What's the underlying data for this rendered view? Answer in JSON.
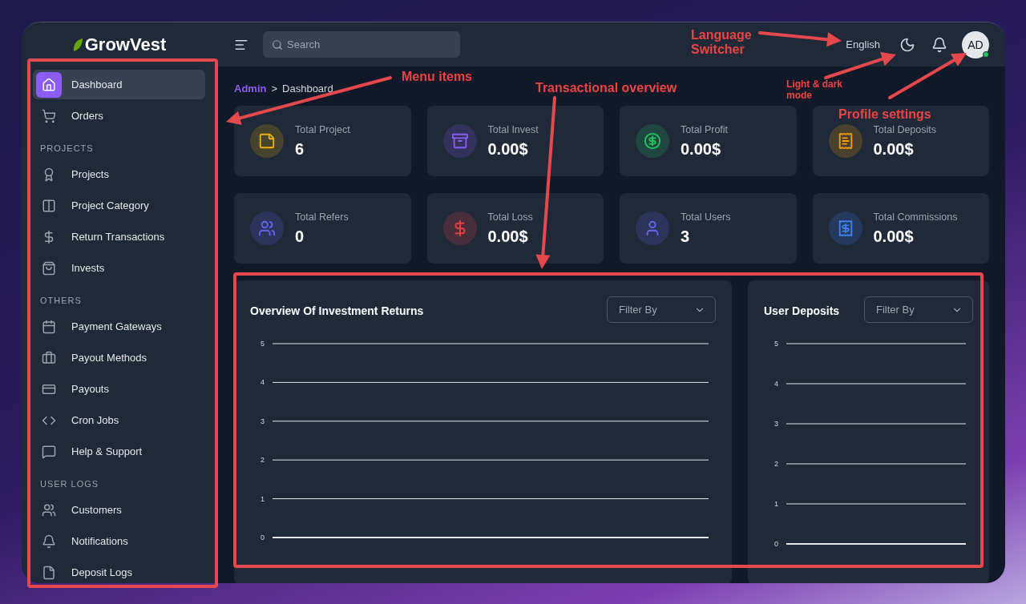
{
  "brand": {
    "name": "GrowVest"
  },
  "search": {
    "placeholder": "Search"
  },
  "topbar": {
    "language": "English",
    "avatar": "AD",
    "online": true
  },
  "sidebar": {
    "sections": [
      {
        "items": [
          {
            "label": "Dashboard",
            "selected": true
          },
          {
            "label": "Orders",
            "selected": false
          }
        ]
      },
      {
        "heading": "PROJECTS",
        "items": [
          {
            "label": "Projects",
            "selected": false
          },
          {
            "label": "Project Category",
            "selected": false
          },
          {
            "label": "Return Transactions",
            "selected": false
          },
          {
            "label": "Invests",
            "selected": false
          }
        ]
      },
      {
        "heading": "OTHERS",
        "items": [
          {
            "label": "Payment Gateways",
            "selected": false
          },
          {
            "label": "Payout Methods",
            "selected": false
          },
          {
            "label": "Payouts",
            "selected": false
          },
          {
            "label": "Cron Jobs",
            "selected": false
          },
          {
            "label": "Help & Support",
            "selected": false
          }
        ]
      },
      {
        "heading": "USER LOGS",
        "items": [
          {
            "label": "Customers",
            "selected": false
          },
          {
            "label": "Notifications",
            "selected": false
          },
          {
            "label": "Deposit Logs",
            "selected": false
          }
        ]
      }
    ]
  },
  "breadcrumb_separator": ">",
  "breadcrumb": [
    {
      "label": "Admin",
      "selected": false
    },
    {
      "label": "Dashboard",
      "selected": true
    }
  ],
  "stats": [
    {
      "label": "Total Project",
      "value": "6",
      "color": "#eab308"
    },
    {
      "label": "Total Invest",
      "value": "0.00$",
      "color": "#8b5cf6"
    },
    {
      "label": "Total Profit",
      "value": "0.00$",
      "color": "#22c55e"
    },
    {
      "label": "Total Deposits",
      "value": "0.00$",
      "color": "#f59e0b"
    },
    {
      "label": "Total Refers",
      "value": "0",
      "color": "#6366f1"
    },
    {
      "label": "Total Loss",
      "value": "0.00$",
      "color": "#ef4444"
    },
    {
      "label": "Total Users",
      "value": "3",
      "color": "#6366f1"
    },
    {
      "label": "Total Commissions",
      "value": "0.00$",
      "color": "#3b82f6"
    }
  ],
  "charts": [
    {
      "title": "Overview Of Investment Returns",
      "filter": "Filter By",
      "gridline_labels": [
        "5",
        "4",
        "3",
        "2",
        "1",
        "0"
      ]
    },
    {
      "title": "User Deposits",
      "filter": "Filter By",
      "gridline_labels": [
        "5",
        "4",
        "3",
        "2",
        "1",
        "0"
      ]
    }
  ],
  "annotations": [
    {
      "kind": "label",
      "text": "Menu items"
    },
    {
      "kind": "label",
      "text": "Transactional overview"
    },
    {
      "kind": "label",
      "text": "Language Switcher"
    },
    {
      "kind": "label",
      "text": "Light & dark mode"
    },
    {
      "kind": "label",
      "text": "Profile settings"
    }
  ]
}
